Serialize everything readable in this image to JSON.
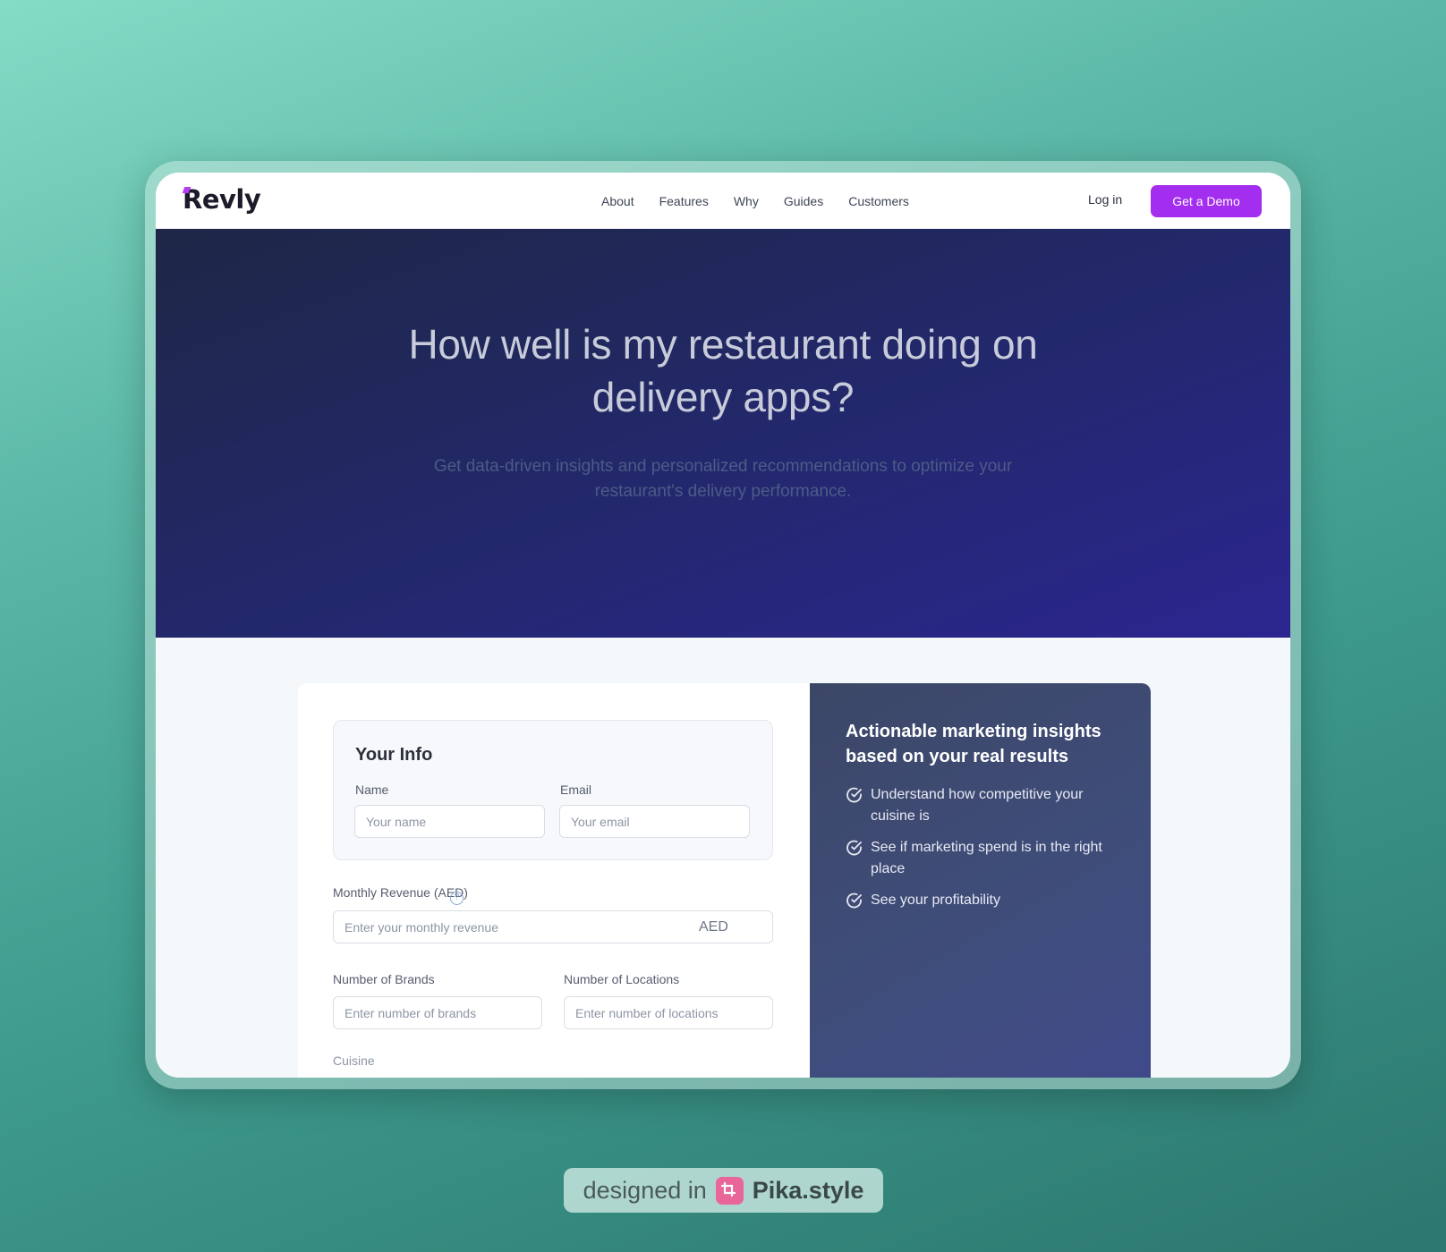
{
  "brand": {
    "name": "Revly",
    "accent_color": "#a42ef0"
  },
  "nav": {
    "links": [
      "About",
      "Features",
      "Why",
      "Guides",
      "Customers"
    ],
    "login_label": "Log in",
    "demo_label": "Get a Demo"
  },
  "hero": {
    "title": "How well is my restaurant doing on delivery apps?",
    "subtitle": "Get data-driven insights and personalized recommendations to optimize your restaurant's delivery performance."
  },
  "form": {
    "info_title": "Your Info",
    "name_label": "Name",
    "name_placeholder": "Your name",
    "email_label": "Email",
    "email_placeholder": "Your email",
    "revenue_label": "Monthly Revenue (AED)",
    "revenue_placeholder": "Enter your monthly revenue",
    "revenue_suffix": "AED",
    "brands_label": "Number of Brands",
    "brands_placeholder": "Enter number of brands",
    "locations_label": "Number of Locations",
    "locations_placeholder": "Enter number of locations",
    "cuisine_label": "Cuisine"
  },
  "benefits": {
    "title": "Actionable marketing insights based on your real results",
    "items": [
      "Understand how competitive your cuisine is",
      "See if marketing spend is in the right place",
      "See your profitability"
    ]
  },
  "watermark": {
    "prefix": "designed in",
    "brand": "Pika.style"
  }
}
